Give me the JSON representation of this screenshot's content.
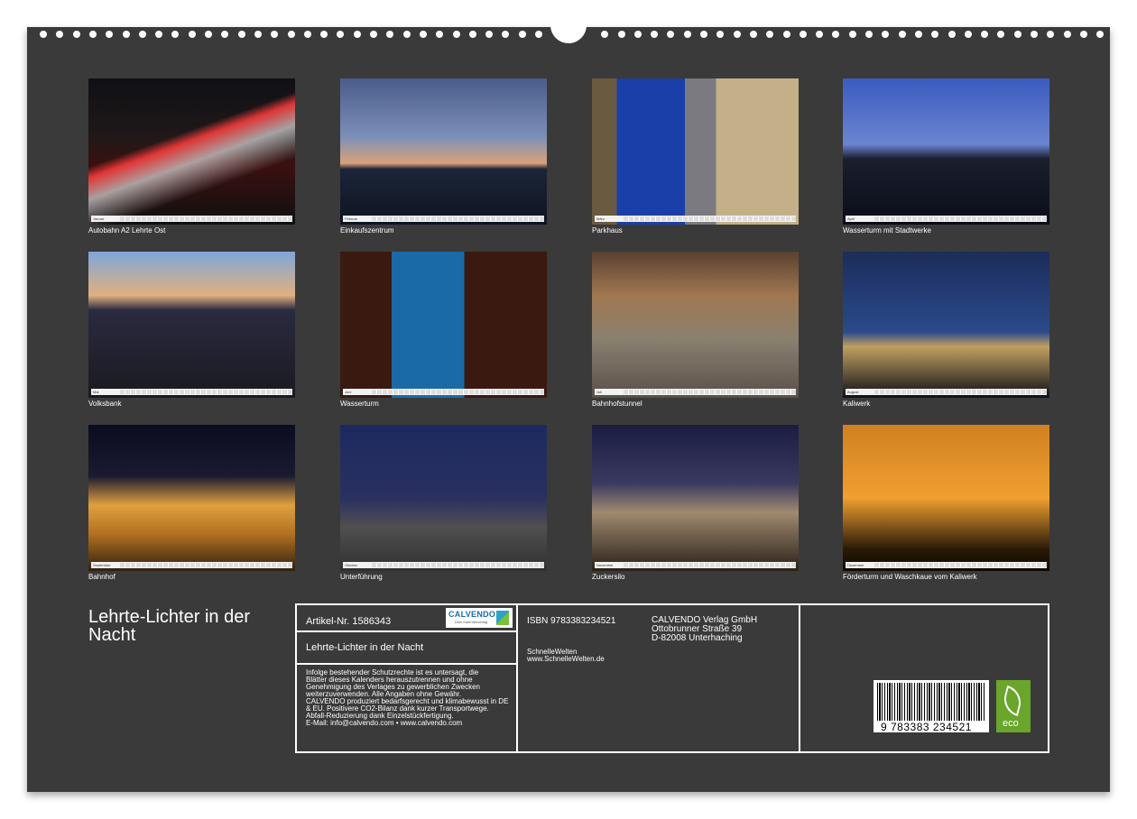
{
  "colors": {
    "sheet": "#3a3a3a",
    "text": "#ffffff",
    "calvendo_blue": "#1b6fa8",
    "eco_green": "#6aa52c"
  },
  "months": [
    {
      "caption": "Autobahn A2 Lehrte Ost",
      "strip": "Januar"
    },
    {
      "caption": "Einkaufszentrum",
      "strip": "Februar"
    },
    {
      "caption": "Parkhaus",
      "strip": "März"
    },
    {
      "caption": "Wasserturm mit Stadtwerke",
      "strip": "April"
    },
    {
      "caption": "Volksbank",
      "strip": "Mai"
    },
    {
      "caption": "Wasserturm",
      "strip": "Juni"
    },
    {
      "caption": "Bahnhofstunnel",
      "strip": "Juli"
    },
    {
      "caption": "Kaliwerk",
      "strip": "August"
    },
    {
      "caption": "Bahnhof",
      "strip": "September"
    },
    {
      "caption": "Unterführung",
      "strip": "Oktober"
    },
    {
      "caption": "Zuckersilo",
      "strip": "November"
    },
    {
      "caption": "Förderturm und Waschkaue vom Kaliwerk",
      "strip": "Dezember"
    }
  ],
  "calendar_title": "Lehrte-Lichter in der Nacht",
  "info": {
    "article_label": "Artikel-Nr. 1586343",
    "logo_text": "CALVENDO",
    "logo_sub": "Dein Kalenderverlag",
    "title": "Lehrte-Lichter in der Nacht",
    "legal": [
      "Infolge bestehender Schutzrechte ist es untersagt, die",
      "Blätter dieses Kalenders herauszutrennen und ohne",
      "Genehmigung des Verlages zu gewerblichen Zwecken",
      "weiterzuverwenden. Alle Angaben ohne Gewähr.",
      "CALVENDO produziert bedarfsgerecht und klimabewusst in DE",
      "& EU. Positivere CO2-Bilanz dank kurzer Transportwege.",
      "Abfall-Reduzierung dank Einzelstückfertigung.",
      "E-Mail: info@calvendo.com • www.calvendo.com"
    ],
    "isbn": "ISBN 9783383234521",
    "publisher": [
      "CALVENDO Verlag GmbH",
      "Ottobrunner Straße 39",
      "D-82008 Unterhaching"
    ],
    "author": [
      "SchnelleWelten",
      "www.SchnelleWelten.de"
    ],
    "barcode_number": "9 783383 234521",
    "eco_label": "eco"
  }
}
